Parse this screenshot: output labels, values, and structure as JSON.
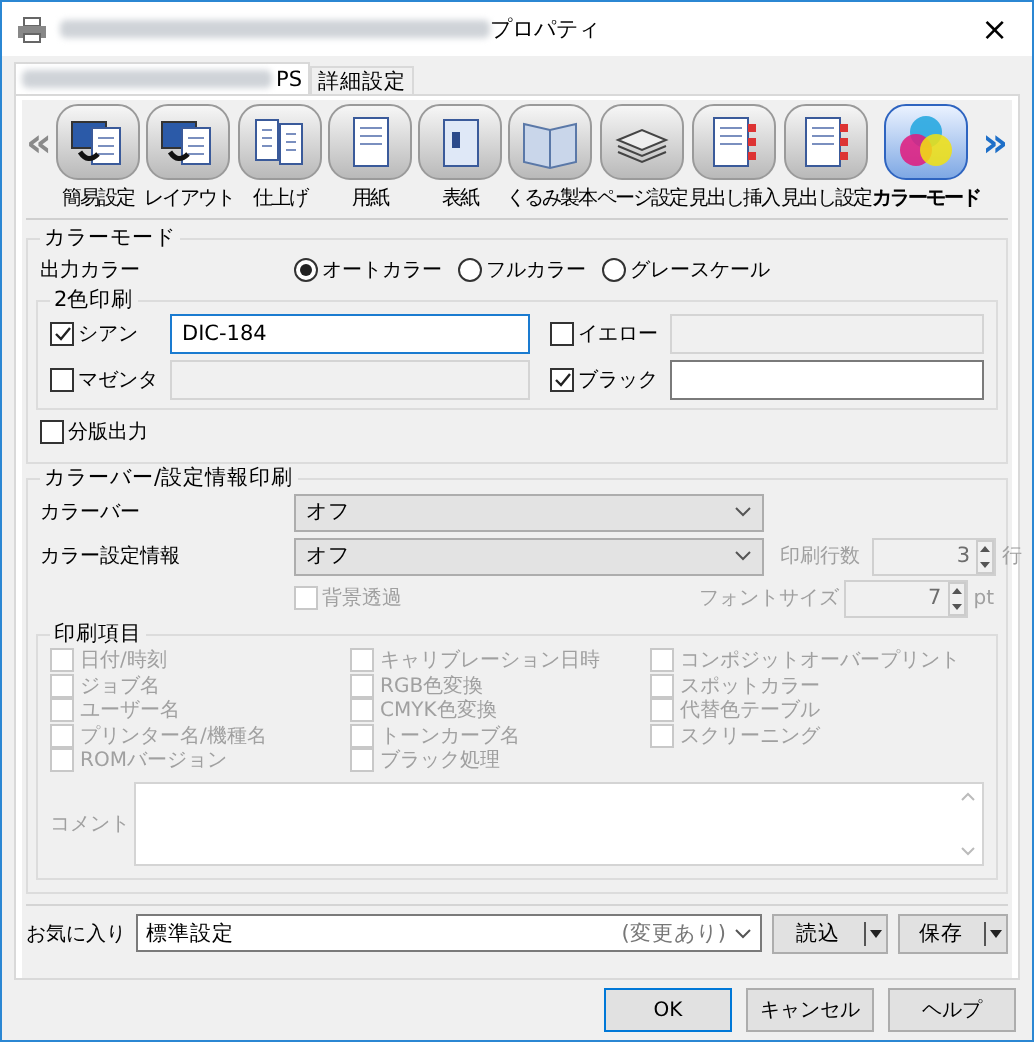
{
  "window": {
    "title": "プロパティ",
    "close": "×"
  },
  "tabs": [
    {
      "label": "PS",
      "selected": true,
      "redacted": true
    },
    {
      "label": "詳細設定",
      "selected": false,
      "redacted": false
    }
  ],
  "nav": {
    "prev": "«",
    "next": "»"
  },
  "categories": [
    {
      "label": "簡易設定",
      "selected": false
    },
    {
      "label": "レイアウト",
      "selected": false
    },
    {
      "label": "仕上げ",
      "selected": false
    },
    {
      "label": "用紙",
      "selected": false
    },
    {
      "label": "表紙",
      "selected": false
    },
    {
      "label": "くるみ製本",
      "selected": false
    },
    {
      "label": "ページ設定",
      "selected": false
    },
    {
      "label": "見出し挿入",
      "selected": false
    },
    {
      "label": "見出し設定",
      "selected": false
    },
    {
      "label": "カラーモード",
      "selected": true
    }
  ],
  "color_mode": {
    "title": "カラーモード",
    "output_color": {
      "label": "出力カラー",
      "options": [
        {
          "label": "オートカラー",
          "selected": true
        },
        {
          "label": "フルカラー",
          "selected": false
        },
        {
          "label": "グレースケール",
          "selected": false
        }
      ]
    },
    "two_color": {
      "title": "2色印刷",
      "items": [
        {
          "label": "シアン",
          "checked": true,
          "value": "DIC-184",
          "disabled": false
        },
        {
          "label": "イエロー",
          "checked": false,
          "disabled": true
        },
        {
          "label": "マゼンタ",
          "checked": false,
          "disabled": true
        },
        {
          "label": "ブラック",
          "checked": true,
          "disabled": false
        }
      ]
    },
    "separation": {
      "label": "分版出力",
      "checked": false
    }
  },
  "color_bar": {
    "title": "カラーバー/設定情報印刷",
    "color_bar": {
      "label": "カラーバー",
      "value": "オフ"
    },
    "color_info": {
      "label": "カラー設定情報",
      "value": "オフ"
    },
    "print_lines": {
      "label": "印刷行数",
      "value": "3",
      "unit": "行"
    },
    "font_size": {
      "label": "フォントサイズ",
      "value": "7",
      "unit": "pt"
    },
    "background": {
      "label": "背景透過",
      "checked": false
    },
    "print_items": {
      "title": "印刷項目",
      "disabled": true,
      "columns": [
        [
          {
            "label": "日付/時刻",
            "checked": false
          },
          {
            "label": "ジョブ名",
            "checked": false
          },
          {
            "label": "ユーザー名",
            "checked": false
          },
          {
            "label": "プリンター名/機種名",
            "checked": false
          },
          {
            "label": "ROMバージョン",
            "checked": false
          }
        ],
        [
          {
            "label": "キャリブレーション日時",
            "checked": false
          },
          {
            "label": "RGB色変換",
            "checked": false
          },
          {
            "label": "CMYK色変換",
            "checked": false
          },
          {
            "label": "トーンカーブ名",
            "checked": false
          },
          {
            "label": "ブラック処理",
            "checked": false
          }
        ],
        [
          {
            "label": "コンポジットオーバープリント",
            "checked": false
          },
          {
            "label": "スポットカラー",
            "checked": false
          },
          {
            "label": "代替色テーブル",
            "checked": false
          },
          {
            "label": "スクリーニング",
            "checked": false
          }
        ]
      ],
      "comment": {
        "label": "コメント"
      }
    }
  },
  "favorites": {
    "label": "お気に入り",
    "value": "標準設定",
    "note": "(変更あり)",
    "buttons": [
      "読込",
      "保存"
    ]
  },
  "buttons": [
    {
      "label": "OK",
      "default": true
    },
    {
      "label": "キャンセル",
      "default": false
    },
    {
      "label": "ヘルプ",
      "default": false
    }
  ]
}
